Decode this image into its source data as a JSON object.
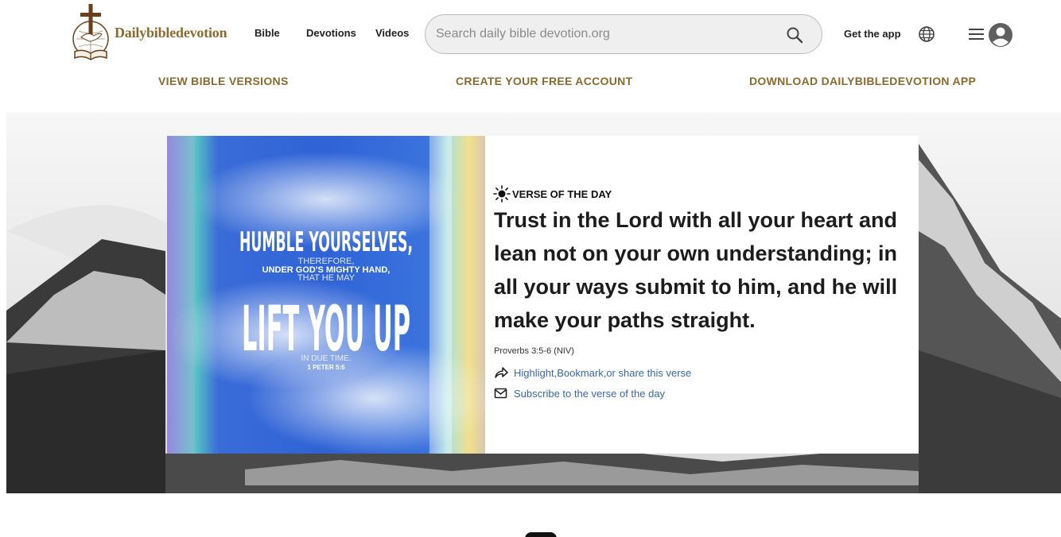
{
  "brand": {
    "name": "Dailybibledevotion"
  },
  "nav": {
    "bible": "Bible",
    "devotions": "Devotions",
    "videos": "Videos"
  },
  "search": {
    "placeholder": "Search daily bible devotion.org",
    "value": ""
  },
  "header": {
    "get_app": "Get the app"
  },
  "subnav": {
    "versions": "VIEW BIBLE VERSIONS",
    "account": "CREATE YOUR FREE ACCOUNT",
    "download": "DOWNLOAD DAILYBIBLEDEVOTION APP"
  },
  "image_text": {
    "line1": "HUMBLE YOURSELVES,",
    "line2": "THEREFORE,",
    "line3": "UNDER GOD'S MIGHTY HAND,",
    "line4": "THAT HE MAY",
    "line5": "LIFT YOU UP",
    "line6": "IN DUE TIME.",
    "line7": "1 PETER 5:6"
  },
  "votd": {
    "label": "VERSE OF THE DAY",
    "verse": "Trust in the Lord with all your heart and lean not on your own understanding; in all your ways submit to him, and he will make your paths straight.",
    "reference": "Proverbs 3:5-6 (NIV)",
    "share": "Highlight,Bookmark,or share this verse",
    "subscribe": "Subscribe to the verse of the day"
  },
  "colors": {
    "brand_gold": "#8a6a2e",
    "link_blue": "#3a67a8"
  },
  "icons": [
    "cross-logo-icon",
    "search-icon",
    "globe-icon",
    "hamburger-menu-icon",
    "user-avatar-icon",
    "sun-icon",
    "share-arrow-icon",
    "mail-icon"
  ]
}
